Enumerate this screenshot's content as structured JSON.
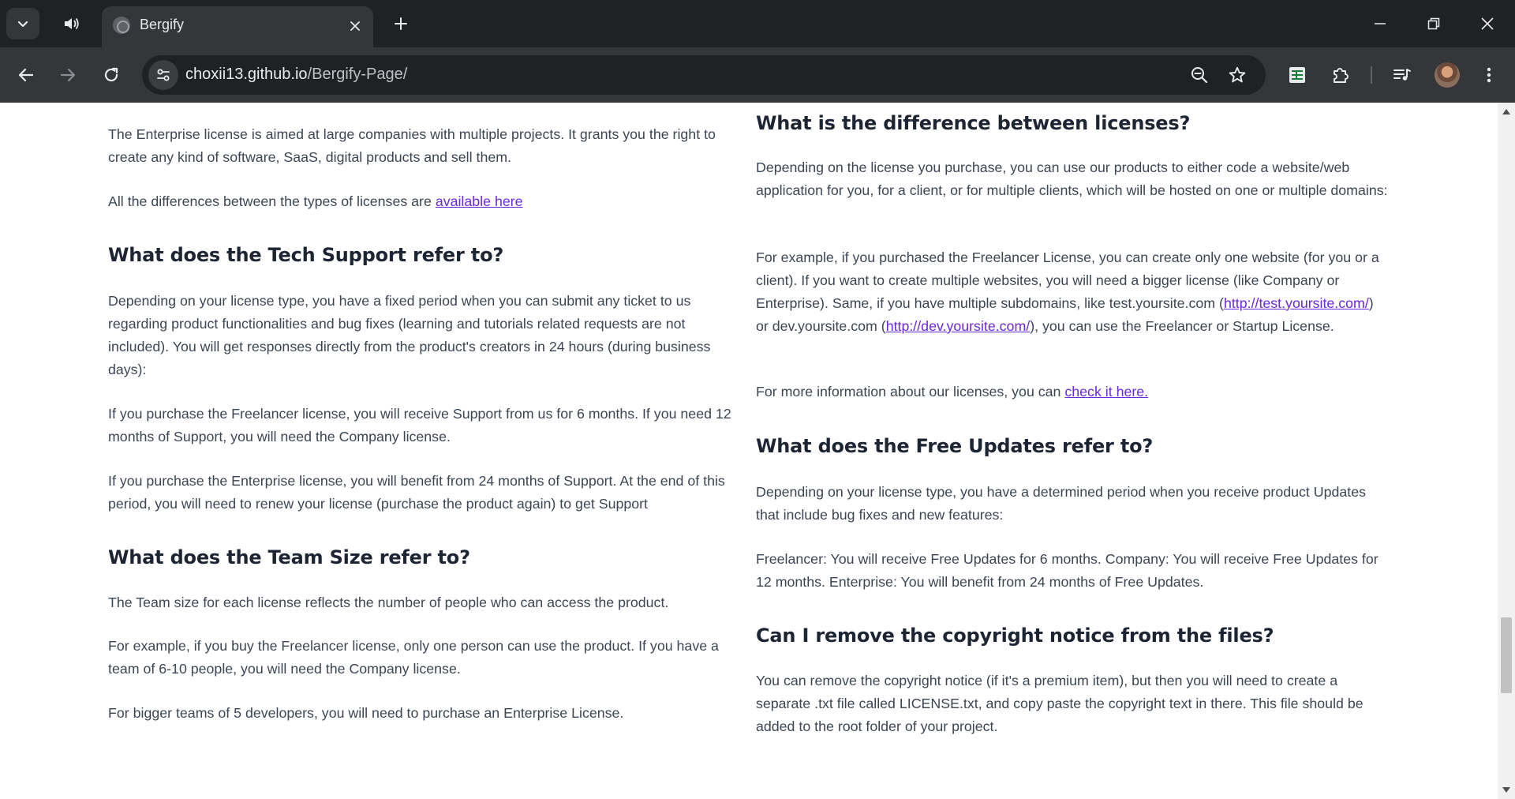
{
  "browser": {
    "tab_title": "Bergify",
    "url_host": "choxii13.github.io",
    "url_path": "/Bergify-Page/",
    "icons": {
      "tab_search": "chevron-down-icon",
      "audio": "speaker-icon",
      "tab_close": "close-icon",
      "new_tab": "plus-icon",
      "minimize": "minimize-icon",
      "restore": "restore-icon",
      "close_window": "close-icon",
      "back": "arrow-left-icon",
      "forward": "arrow-right-icon",
      "reload": "reload-icon",
      "site_info": "tune-icon",
      "zoom": "zoom-out-icon",
      "bookmark": "star-icon",
      "extension_sheet": "sheet-icon",
      "extensions": "puzzle-icon",
      "media": "media-queue-icon",
      "profile": "avatar",
      "menu": "more-vert-icon"
    },
    "colors": {
      "tabstrip": "#202124",
      "toolbar": "#35363a",
      "omnibox": "#202124"
    }
  },
  "content": {
    "link_color": "#6d28d9",
    "left": {
      "p_enterprise": "The Enterprise license is aimed at large companies with multiple projects. It grants you the right to create any kind of software, SaaS, digital products and sell them.",
      "p_differences_prefix": "All the differences between the types of licenses are ",
      "p_differences_link": "available here",
      "h_tech_support": "What does the Tech Support refer to?",
      "p_tech_1": "Depending on your license type, you have a fixed period when you can submit any ticket to us regarding product functionalities and bug fixes (learning and tutorials related requests are not included). You will get responses directly from the product's creators in 24 hours (during business days):",
      "p_tech_2": "If you purchase the Freelancer license, you will receive Support from us for 6 months. If you need 12 months of Support, you will need the Company license.",
      "p_tech_3": "If you purchase the Enterprise license, you will benefit from 24 months of Support. At the end of this period, you will need to renew your license (purchase the product again) to get Support",
      "h_team_size": "What does the Team Size refer to?",
      "p_team_1": "The Team size for each license reflects the number of people who can access the product.",
      "p_team_2": "For example, if you buy the Freelancer license, only one person can use the product. If you have a team of 6-10 people, you will need the Company license.",
      "p_team_3": "For bigger teams of 5 developers, you will need to purchase an Enterprise License."
    },
    "right": {
      "h_difference": "What is the difference between licenses?",
      "p_diff_1": "Depending on the license you purchase, you can use our products to either code a website/web application for you, for a client, or for multiple clients, which will be hosted on one or multiple domains:",
      "p_diff_2_a": "For example, if you purchased the Freelancer License, you can create only one website (for you or a client). If you want to create multiple websites, you will need a bigger license (like Company or Enterprise). Same, if you have multiple subdomains, like test.yoursite.com (",
      "p_diff_2_link1": "http://test.yoursite.com/",
      "p_diff_2_b": ") or dev.yoursite.com (",
      "p_diff_2_link2": "http://dev.yoursite.com/",
      "p_diff_2_c": "), you can use the Freelancer or Startup License.",
      "p_diff_3_prefix": "For more information about our licenses, you can ",
      "p_diff_3_link": "check it here.",
      "h_free_updates": "What does the Free Updates refer to?",
      "p_updates_1": "Depending on your license type, you have a determined period when you receive product Updates that include bug fixes and new features:",
      "p_updates_2": "Freelancer: You will receive Free Updates for 6 months. Company: You will receive Free Updates for 12 months. Enterprise: You will benefit from 24 months of Free Updates.",
      "h_copyright": "Can I remove the copyright notice from the files?",
      "p_copyright": "You can remove the copyright notice (if it's a premium item), but then you will need to create a separate .txt file called LICENSE.txt, and copy paste the copyright text in there. This file should be added to the root folder of your project."
    }
  }
}
